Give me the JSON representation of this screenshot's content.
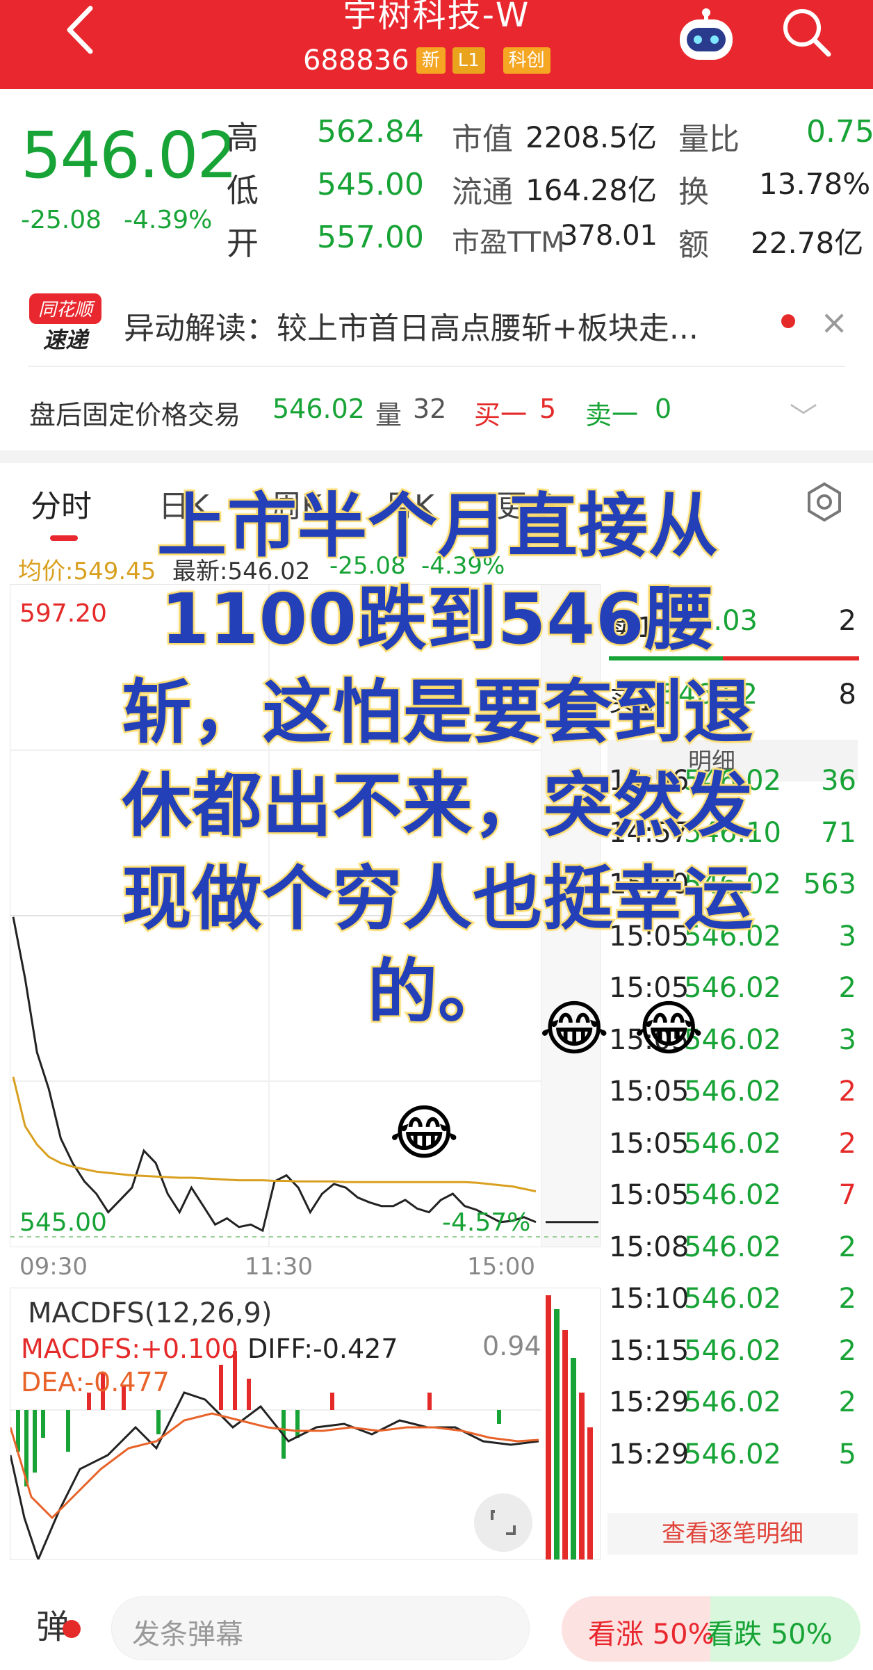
{
  "header": {
    "title": "宇树科技-W",
    "code": "688836",
    "tags": [
      "新",
      "L1",
      "科创"
    ]
  },
  "quote": {
    "price": "546.02",
    "change": "-25.08",
    "change_pct": "-4.39%",
    "high_label": "高",
    "high": "562.84",
    "low_label": "低",
    "low": "545.00",
    "open_label": "开",
    "open": "557.00",
    "mcap_label": "市值",
    "mcap": "2208.5亿",
    "float_label": "流通",
    "float": "164.28亿",
    "pe_label": "市盈TTM",
    "pe": "378.01",
    "vol_ratio_label": "量比",
    "vol_ratio": "0.75",
    "turnover_label": "换",
    "turnover": "13.78%",
    "amount_label": "额",
    "amount": "22.78亿"
  },
  "news": {
    "logo_line1": "同花顺",
    "logo_line2": "速递",
    "text": "异动解读：较上市首日高点腰斩+板块走..."
  },
  "after_hours": {
    "label": "盘后固定价格交易",
    "price": "546.02",
    "vol_label": "量",
    "vol": "32",
    "buy1_label": "买一",
    "buy1": "5",
    "sell1_label": "卖一",
    "sell1": "0"
  },
  "tabs": [
    "分时",
    "日K",
    "周K",
    "月K",
    "更多"
  ],
  "avg_line": {
    "avg": "均价:549.45",
    "latest": "最新:546.02",
    "chg": "-25.08",
    "pct": "-4.39%"
  },
  "chart_data": {
    "type": "line",
    "title": "",
    "x_ticks": [
      "09:30",
      "11:30",
      "15:00"
    ],
    "y_top_label": "597.20",
    "y_bottom_label": "545.00",
    "bottom_pct_label": "-4.57%",
    "ylim": [
      545.0,
      597.2
    ],
    "series": [
      {
        "values": [
          571,
          566,
          560,
          557,
          553,
          551,
          549.5,
          548.5,
          547,
          548,
          549,
          552,
          551,
          548.5,
          547,
          549,
          547.5,
          546,
          546.5,
          545.8,
          546,
          545.5,
          549.5,
          550,
          549,
          547,
          548.5,
          549.3,
          549,
          548.2,
          547.8,
          547.5,
          547.5,
          548,
          547.3,
          547,
          548,
          548.5,
          547.5,
          547.2,
          546.7,
          546.2,
          546.3,
          546.6,
          546.2
        ]
      },
      {
        "values": [
          558,
          554,
          552.5,
          551.5,
          551,
          550.7,
          550.5,
          550.3,
          550.2,
          550.1,
          550.0,
          549.95,
          549.9,
          549.85,
          549.8,
          549.8,
          549.75,
          549.7,
          549.65,
          549.6,
          549.6,
          549.6,
          549.55,
          549.55,
          549.5,
          549.5,
          549.5,
          549.5,
          549.45,
          549.45,
          549.45,
          549.45,
          549.45,
          549.45,
          549.45,
          549.45,
          549.45,
          549.45,
          549.45,
          549.4,
          549.3,
          549.2,
          549.1,
          548.9,
          548.7
        ]
      }
    ]
  },
  "macd": {
    "title": "MACDFS(12,26,9)",
    "macd": "MACDFS:+0.100",
    "diff": "DIFF:-0.427",
    "dea": "DEA:-0.477",
    "max": "0.94"
  },
  "ticks_panel": {
    "sell1_label": "卖1",
    "sell1_price": "546.03",
    "sell1_vol": "2",
    "buy1_label": "买1",
    "buy1_price": "546.02",
    "buy1_vol": "8",
    "header": "明细",
    "rows": [
      {
        "time": "14:56",
        "price": "546.02",
        "vol": "36",
        "dir": "g"
      },
      {
        "time": "14:57",
        "price": "546.10",
        "vol": "71",
        "dir": "g"
      },
      {
        "time": "15:00",
        "price": "546.02",
        "vol": "563",
        "dir": "g"
      },
      {
        "time": "15:05",
        "price": "546.02",
        "vol": "3",
        "dir": "g"
      },
      {
        "time": "15:05",
        "price": "546.02",
        "vol": "2",
        "dir": "g"
      },
      {
        "time": "15:05",
        "price": "546.02",
        "vol": "3",
        "dir": "g"
      },
      {
        "time": "15:05",
        "price": "546.02",
        "vol": "2",
        "dir": "r"
      },
      {
        "time": "15:05",
        "price": "546.02",
        "vol": "2",
        "dir": "r"
      },
      {
        "time": "15:05",
        "price": "546.02",
        "vol": "7",
        "dir": "r"
      },
      {
        "time": "15:08",
        "price": "546.02",
        "vol": "2",
        "dir": "g"
      },
      {
        "time": "15:10",
        "price": "546.02",
        "vol": "2",
        "dir": "g"
      },
      {
        "time": "15:15",
        "price": "546.02",
        "vol": "2",
        "dir": "g"
      },
      {
        "time": "15:29",
        "price": "546.02",
        "vol": "2",
        "dir": "g"
      },
      {
        "time": "15:29",
        "price": "546.02",
        "vol": "5",
        "dir": "g"
      }
    ],
    "more_label": "查看逐笔明细"
  },
  "bottom": {
    "danmu_icon": "弹",
    "danmu_placeholder": "发条弹幕",
    "bull_label": "看涨 50%",
    "bear_label": "看跌 50%"
  },
  "caption": {
    "text": "上市半个月直接从1100跌到546腰斩，这怕是要套到退休都出不来，突然发现做个穷人也挺幸运的。",
    "emoji": "😂"
  },
  "colors": {
    "accent_red": "#e8282e",
    "down_green": "#17a336",
    "avg_line": "#d9a020",
    "caption_blue": "#2340b8",
    "caption_outline": "#fde37e"
  }
}
